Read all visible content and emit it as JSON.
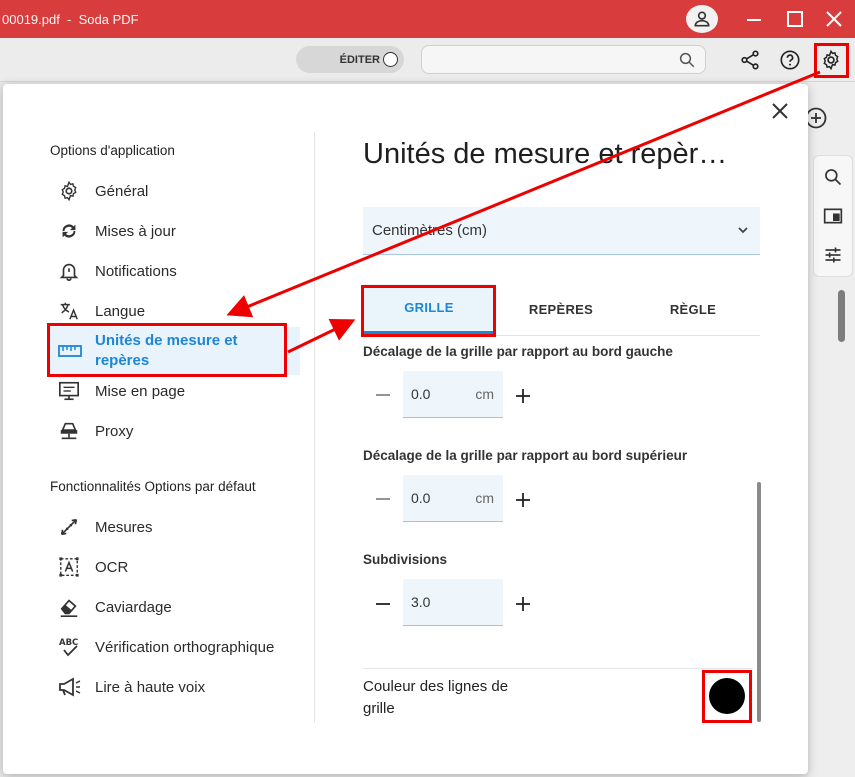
{
  "window": {
    "title": "00019.pdf  -  Soda PDF",
    "controls": [
      "minimize",
      "maximize",
      "close"
    ]
  },
  "toolbar": {
    "edit_label": "ÉDITER",
    "search_placeholder": "",
    "icons": [
      "share-icon",
      "help-icon",
      "gear-icon"
    ]
  },
  "sidebar": {
    "section1_title": "Options d'application",
    "items": [
      {
        "label": "Général",
        "icon": "gear-icon"
      },
      {
        "label": "Mises à jour",
        "icon": "sync-icon"
      },
      {
        "label": "Notifications",
        "icon": "bell-icon"
      },
      {
        "label": "Langue",
        "icon": "translate-icon"
      },
      {
        "label": "Unités de mesure et repères",
        "icon": "ruler-icon",
        "active": true
      },
      {
        "label": "Mise en page",
        "icon": "monitor-icon"
      },
      {
        "label": "Proxy",
        "icon": "network-icon"
      }
    ],
    "section2_title": "Fonctionnalités Options par défaut",
    "items2": [
      {
        "label": "Mesures",
        "icon": "measure-icon"
      },
      {
        "label": "OCR",
        "icon": "ocr-icon"
      },
      {
        "label": "Caviardage",
        "icon": "eraser-icon"
      },
      {
        "label": "Vérification orthographique",
        "icon": "spellcheck-icon"
      },
      {
        "label": "Lire à haute voix",
        "icon": "megaphone-icon"
      }
    ]
  },
  "panel": {
    "title": "Unités de mesure et repèr…",
    "unit_select": "Centimètres (cm)",
    "tabs": [
      "GRILLE",
      "REPÈRES",
      "RÈGLE"
    ],
    "active_tab": "GRILLE",
    "fields": [
      {
        "label": "Décalage de la grille par rapport au bord gauche",
        "value": "0.0",
        "unit": "cm"
      },
      {
        "label": "Décalage de la grille par rapport au bord supérieur",
        "value": "0.0",
        "unit": "cm"
      },
      {
        "label": "Subdivisions",
        "value": "3.0",
        "unit": ""
      }
    ],
    "color_label": "Couleur des lignes de grille",
    "color_value": "#000000"
  },
  "colors": {
    "titlebar": "#d93c3c",
    "accent": "#1d86d6",
    "highlight": "#ee0000"
  }
}
